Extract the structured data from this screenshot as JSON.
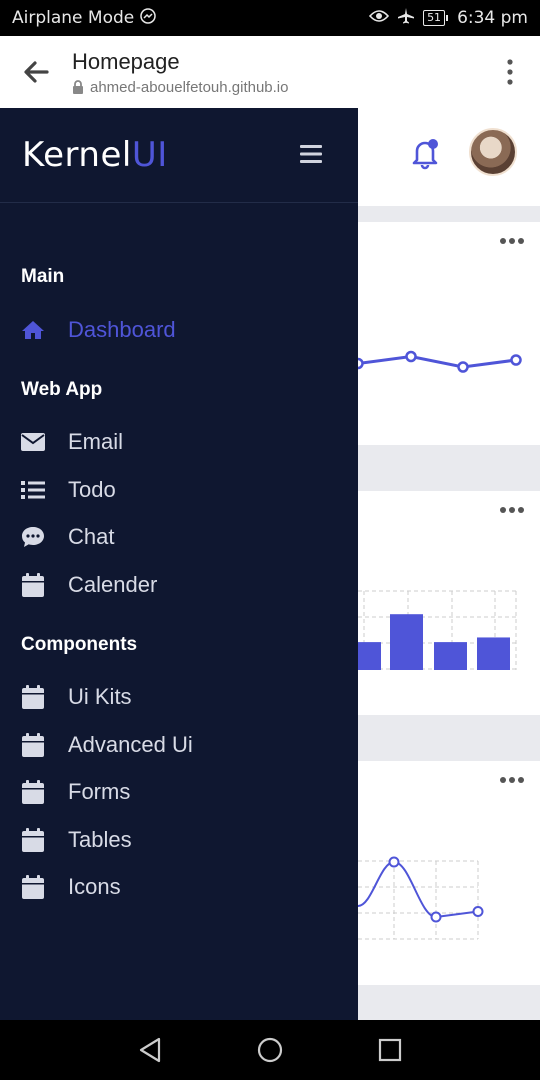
{
  "status_bar": {
    "left_text": "Airplane Mode",
    "battery": "51",
    "time": "6:34 pm"
  },
  "browser": {
    "title": "Homepage",
    "url": "ahmed-abouelfetouh.github.io"
  },
  "sidebar": {
    "brand_part1": "Kernel",
    "brand_part2": "UI",
    "sections": {
      "main": "Main",
      "web_app": "Web App",
      "components": "Components"
    },
    "items": {
      "dashboard": "Dashboard",
      "email": "Email",
      "todo": "Todo",
      "chat": "Chat",
      "calender": "Calender",
      "ui_kits": "Ui Kits",
      "advanced_ui": "Advanced Ui",
      "forms": "Forms",
      "tables": "Tables",
      "icons": "Icons"
    },
    "accent_color": "#4f55d8",
    "background_color": "#0f1730"
  },
  "chart_data": [
    {
      "type": "line",
      "values": [
        3,
        5,
        2,
        4
      ],
      "note": "partially hidden line chart in card 1"
    },
    {
      "type": "bar",
      "values": [
        3,
        6,
        3,
        3.5
      ],
      "note": "partially hidden bar chart in card 2"
    },
    {
      "type": "line",
      "values": [
        1,
        5,
        0,
        0.5
      ],
      "note": "partially hidden curve chart in card 3"
    }
  ]
}
